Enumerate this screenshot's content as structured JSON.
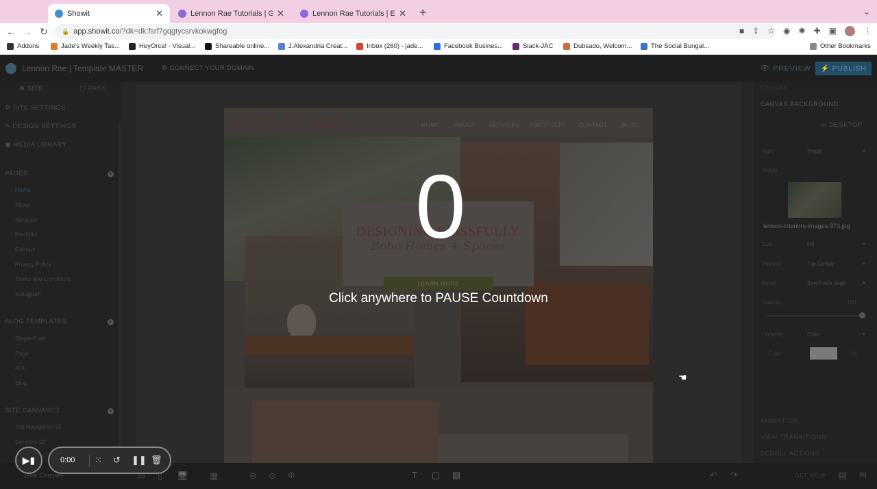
{
  "browser": {
    "tabs": [
      {
        "title": "Showit",
        "active": true
      },
      {
        "title": "Lennon Rae Tutorials | Getting",
        "active": false
      },
      {
        "title": "Lennon Rae Tutorials | Editing",
        "active": false
      }
    ],
    "new_tab": "+",
    "url_host": "app.showit.co",
    "url_rest": "/?dk=dk:fsrf7gqgtycsrvkokwgfog",
    "bookmarks": [
      "Addons",
      "Jade's Weekly Tas...",
      "HeyOrca! - Visual...",
      "Shareable online...",
      "J.Alexandria Creat...",
      "Inbox (260) - jade...",
      "Facebook Busines...",
      "Slack-JAC",
      "Dubsado, Welcom...",
      "The Social Bungal...",
      "Other Bookmarks"
    ]
  },
  "showit": {
    "site_name": "Lennon Rae | Template MASTER",
    "connect_domain": "CONNECT YOUR DOMAIN",
    "preview": "PREVIEW",
    "publish": "PUBLISH",
    "left": {
      "tab_site": "SITE",
      "tab_page": "PAGE",
      "site_settings": "SITE SETTINGS",
      "design_settings": "DESIGN SETTINGS",
      "media_library": "MEDIA LIBRARY",
      "pages_head": "PAGES",
      "pages": [
        "Home",
        "About",
        "Services",
        "Portfolio",
        "Contact",
        "Privacy Policy",
        "Terms and Conditions",
        "Instagram"
      ],
      "blog_head": "BLOG TEMPLATES",
      "blog": [
        "Single-Post",
        "Page",
        "404",
        "Blog"
      ],
      "canvases_head": "SITE CANVASES",
      "canvases": [
        "Top Navigation 01",
        "Services 02"
      ]
    },
    "right": {
      "canvas": "CANVAS",
      "canvas_bg": "CANVAS BACKGROUND",
      "desktop": "DESKTOP",
      "type_label": "Type",
      "type_value": "Image",
      "image_label": "Image",
      "image_name": "lennon-interiors-images-373.jpg",
      "size_label": "Size",
      "size_value": "Fill",
      "position_label": "Position",
      "position_value": "Top Center",
      "scroll_label": "Scroll",
      "scroll_value": "Scroll with page",
      "opacity_label": "Opacity",
      "opacity_value": "100",
      "underlay_label": "Underlay",
      "underlay_value": "Color",
      "color_label": "Color",
      "color_value": "100",
      "animation": "ANIMATION",
      "view_transitions": "VIEW TRANSITIONS",
      "scroll_actions": "SCROLL ACTIONS"
    },
    "page": {
      "logo": "LENNON RAE",
      "logo_script": "interiors",
      "nav": [
        "HOME",
        "ABOUT",
        "SERVICES",
        "PORTFOLIO",
        "CONTACT",
        "BLOG"
      ],
      "hero_title": "DESIGNING BLISSFULLY",
      "hero_script": "Boho Homes + Spaces",
      "learn_more": "LEARN MORE"
    },
    "bottom": {
      "user": "Jade Chesser",
      "get_help": "GET HELP"
    }
  },
  "overlay": {
    "countdown": "0",
    "message": "Click anywhere to PAUSE Countdown"
  },
  "recorder": {
    "time": "0:00"
  }
}
